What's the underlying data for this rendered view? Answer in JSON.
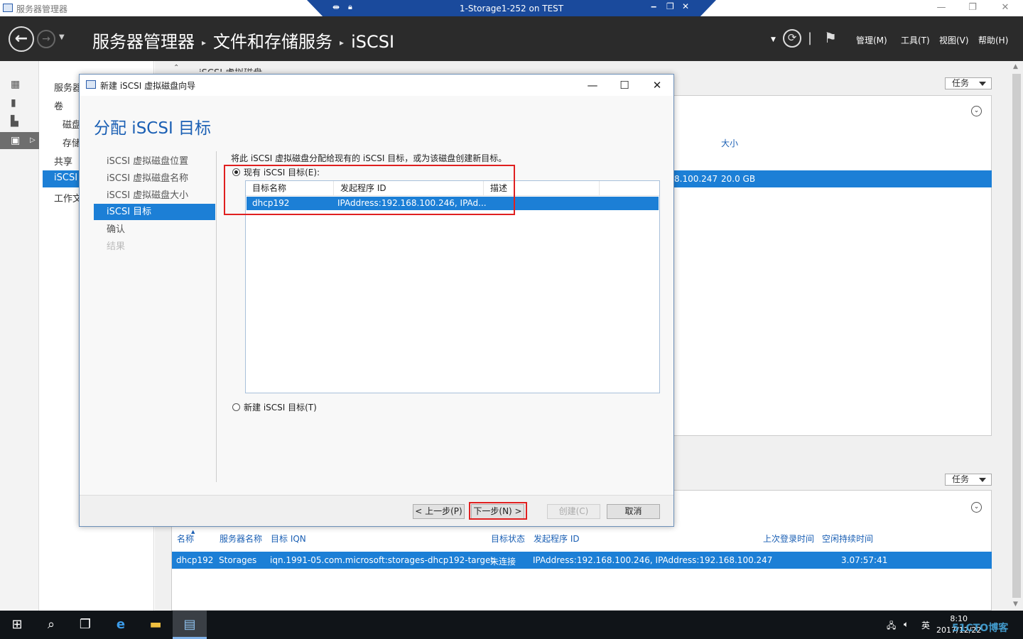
{
  "outer_window": {
    "title": "服务器管理器"
  },
  "rdp_bar": {
    "title": "1-Storage1-252 on TEST"
  },
  "header": {
    "breadcrumb": [
      "服务器管理器",
      "文件和存储服务",
      "iSCSI"
    ],
    "menus": {
      "manage": "管理(M)",
      "tools": "工具(T)",
      "view": "视图(V)",
      "help": "帮助(H)"
    },
    "divider": "|"
  },
  "left_nav": {
    "items": [
      "服务器",
      "卷",
      "磁盘",
      "存储",
      "共享",
      "iSCSI",
      "工作文"
    ]
  },
  "background": {
    "section_title": "iSCSI 虚拟磁盘",
    "tasks_label": "任务",
    "panel1": {
      "size_header": "大小",
      "row_ip_fragment": "8.100.247",
      "row_size": "20.0 GB"
    },
    "panel2": {
      "columns": [
        "名称",
        "服务器名称",
        "目标 IQN",
        "目标状态",
        "发起程序 ID",
        "上次登录时间",
        "空闲持续时间"
      ],
      "row": {
        "name": "dhcp192",
        "server": "Storages",
        "iqn": "iqn.1991-05.com.microsoft:storages-dhcp192-target",
        "status": "未连接",
        "initiator": "IPAddress:192.168.100.246, IPAddress:192.168.100.247",
        "last_login": "",
        "idle": "3.07:57:41"
      }
    }
  },
  "wizard": {
    "title": "新建 iSCSI 虚拟磁盘向导",
    "heading": "分配 iSCSI 目标",
    "steps": [
      {
        "label": "iSCSI 虚拟磁盘位置",
        "state": "normal"
      },
      {
        "label": "iSCSI 虚拟磁盘名称",
        "state": "normal"
      },
      {
        "label": "iSCSI 虚拟磁盘大小",
        "state": "normal"
      },
      {
        "label": "iSCSI 目标",
        "state": "active"
      },
      {
        "label": "确认",
        "state": "normal"
      },
      {
        "label": "结果",
        "state": "disabled"
      }
    ],
    "intro": "将此 iSCSI 虚拟磁盘分配给现有的 iSCSI 目标，或为该磁盘创建新目标。",
    "radio_existing": "现有 iSCSI 目标(E):",
    "radio_new": "新建 iSCSI 目标(T)",
    "table": {
      "columns": [
        "目标名称",
        "发起程序 ID",
        "描述"
      ],
      "rows": [
        {
          "name": "dhcp192",
          "initiator": "IPAddress:192.168.100.246, IPAd...",
          "description": ""
        }
      ]
    },
    "buttons": {
      "prev": "< 上一步(P)",
      "next": "下一步(N) >",
      "create": "创建(C)",
      "cancel": "取消"
    }
  },
  "taskbar": {
    "tray": {
      "ime": "英"
    },
    "clock": {
      "time": "8:10",
      "date": "2017/12/22"
    },
    "watermark": "51CTO博客"
  },
  "colors": {
    "accent": "#1c7fd6",
    "header_bg": "#2b2b2b",
    "highlight_red": "#e02020",
    "rdp_bar": "#1a4a9c"
  }
}
